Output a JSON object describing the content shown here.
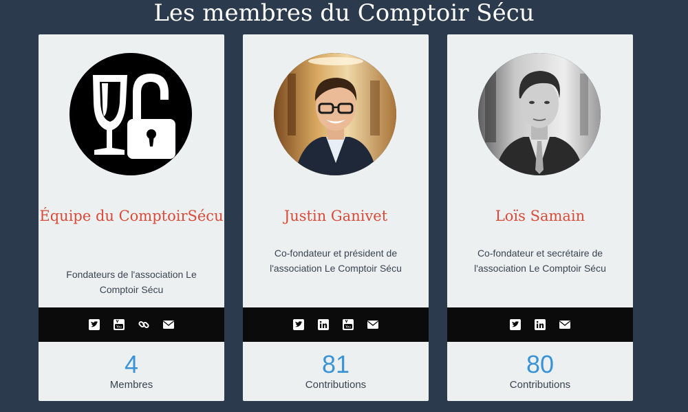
{
  "page": {
    "title": "Les membres du Comptoir Sécu"
  },
  "members": [
    {
      "name": "Équipe du ComptoirSécu",
      "description": "Fondateurs de l'association Le Comptoir Sécu",
      "avatar": "wine-glass-padlock-logo",
      "social": [
        "twitter-icon",
        "youtube-icon",
        "link-icon",
        "email-icon"
      ],
      "count": "4",
      "count_label": "Membres"
    },
    {
      "name": "Justin Ganivet",
      "description": "Co-fondateur et président de l'association Le Comptoir Sécu",
      "avatar": "photo-justin-ganivet",
      "social": [
        "twitter-icon",
        "linkedin-icon",
        "youtube-icon",
        "email-icon"
      ],
      "count": "81",
      "count_label": "Contributions"
    },
    {
      "name": "Loïs Samain",
      "description": "Co-fondateur et secrétaire de l'association Le Comptoir Sécu",
      "avatar": "photo-lois-samain",
      "social": [
        "twitter-icon",
        "linkedin-icon",
        "email-icon"
      ],
      "count": "80",
      "count_label": "Contributions"
    }
  ],
  "colors": {
    "background": "#2b3a4d",
    "card": "#ecf0f1",
    "name": "#d94a38",
    "count": "#3a93d6",
    "social_bar": "#0b0b0b"
  }
}
